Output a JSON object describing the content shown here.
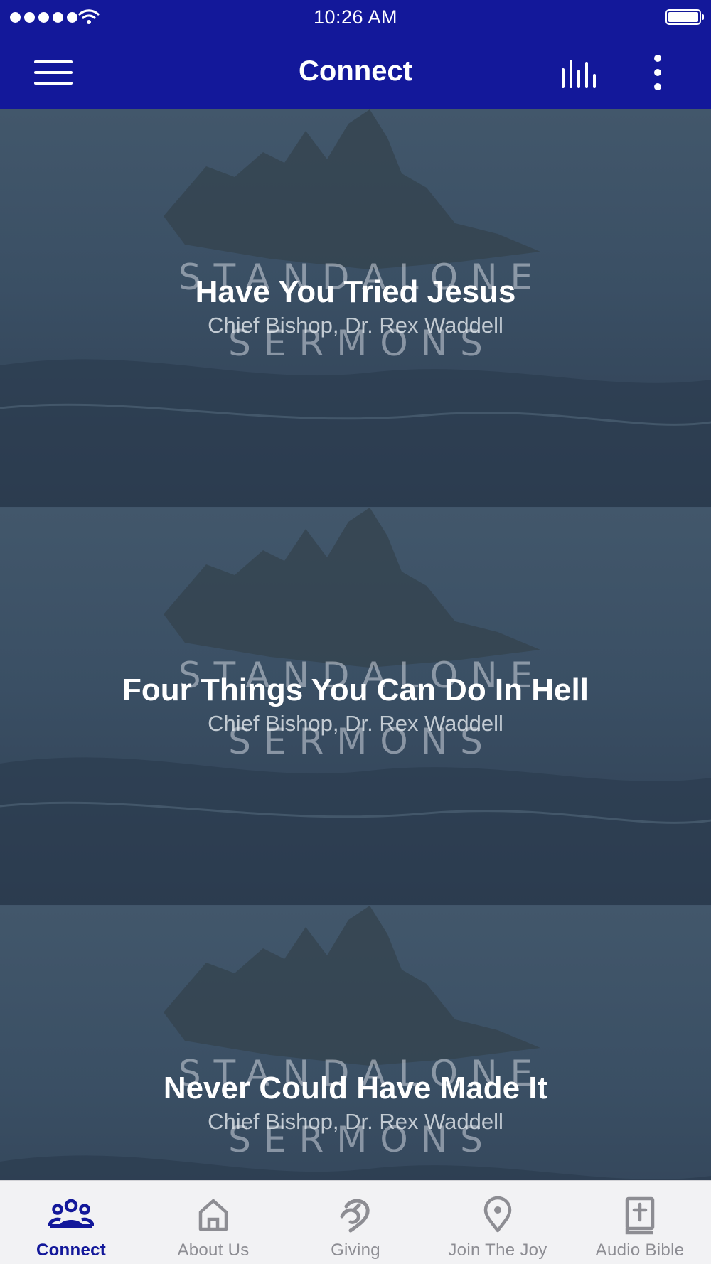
{
  "status_bar": {
    "time": "10:26 AM"
  },
  "app_bar": {
    "title": "Connect",
    "icons": [
      "menu-icon",
      "audio-bars-icon",
      "more-vertical-icon"
    ]
  },
  "theme": {
    "primary": "#13189a",
    "tab_inactive": "#8d8d93",
    "tab_bar_bg": "#f2f2f4"
  },
  "sermons": [
    {
      "artwork_text": [
        "STANDALONE",
        "SERMONS"
      ],
      "title": "Have You Tried Jesus",
      "speaker": "Chief Bishop, Dr. Rex Waddell"
    },
    {
      "artwork_text": [
        "STANDALONE",
        "SERMONS"
      ],
      "title": "Four Things You Can Do In Hell",
      "speaker": "Chief Bishop, Dr. Rex Waddell"
    },
    {
      "artwork_text": [
        "STANDALONE",
        "SERMONS"
      ],
      "title": "Never Could Have Made It",
      "speaker": "Chief Bishop, Dr. Rex Waddell"
    }
  ],
  "tabs": [
    {
      "label": "Connect",
      "icon": "people-icon",
      "active": true
    },
    {
      "label": "About Us",
      "icon": "home-icon",
      "active": false
    },
    {
      "label": "Giving",
      "icon": "giving-icon",
      "active": false
    },
    {
      "label": "Join The Joy",
      "icon": "location-pin-icon",
      "active": false
    },
    {
      "label": "Audio Bible",
      "icon": "bible-icon",
      "active": false
    }
  ]
}
